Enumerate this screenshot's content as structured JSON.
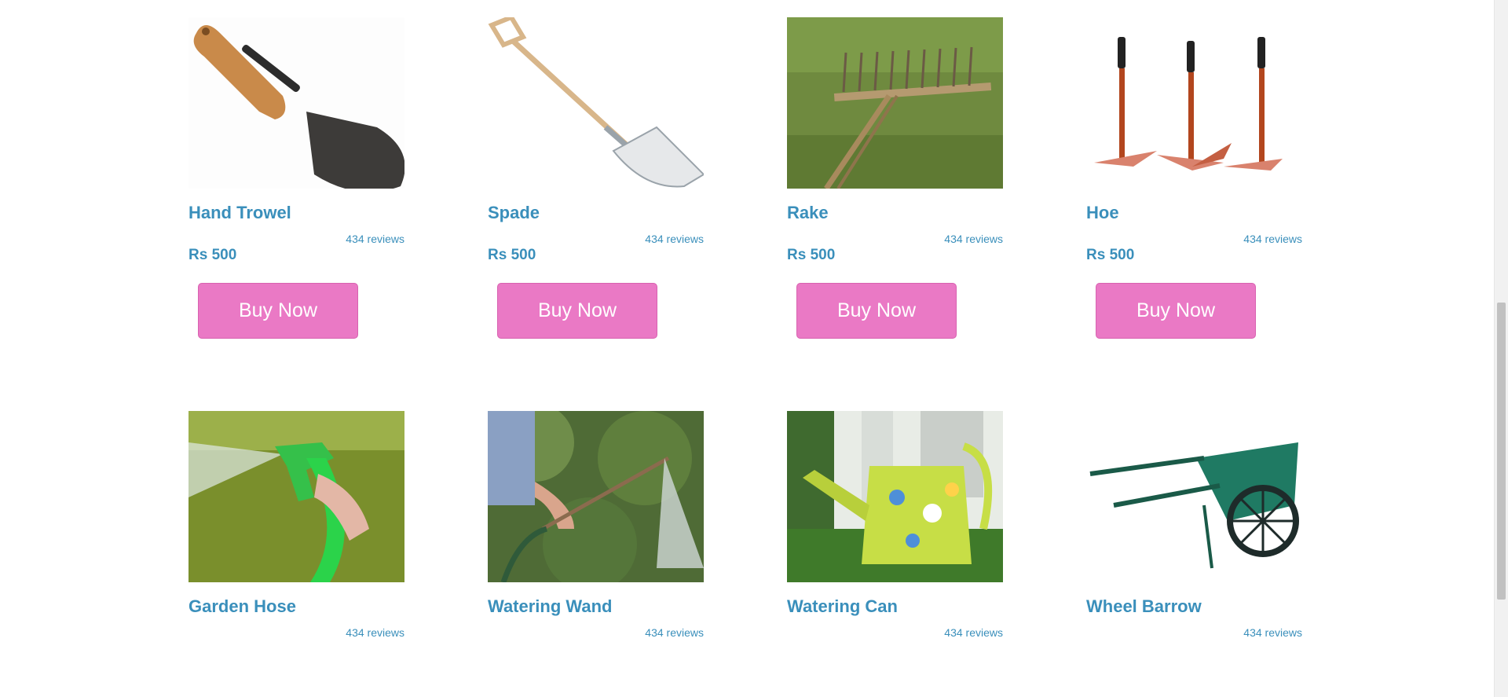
{
  "products": [
    {
      "name": "Hand Trowel",
      "reviews": "434 reviews",
      "price": "Rs 500",
      "button": "Buy Now",
      "icon": "hand-trowel-image"
    },
    {
      "name": "Spade",
      "reviews": "434 reviews",
      "price": "Rs 500",
      "button": "Buy Now",
      "icon": "spade-image"
    },
    {
      "name": "Rake",
      "reviews": "434 reviews",
      "price": "Rs 500",
      "button": "Buy Now",
      "icon": "rake-image"
    },
    {
      "name": "Hoe",
      "reviews": "434 reviews",
      "price": "Rs 500",
      "button": "Buy Now",
      "icon": "hoe-image"
    },
    {
      "name": "Garden Hose",
      "reviews": "434 reviews",
      "price": "",
      "button": "",
      "icon": "garden-hose-image"
    },
    {
      "name": "Watering Wand",
      "reviews": "434 reviews",
      "price": "",
      "button": "",
      "icon": "watering-wand-image"
    },
    {
      "name": "Watering Can",
      "reviews": "434 reviews",
      "price": "",
      "button": "",
      "icon": "watering-can-image"
    },
    {
      "name": "Wheel Barrow",
      "reviews": "434 reviews",
      "price": "",
      "button": "",
      "icon": "wheel-barrow-image"
    }
  ],
  "colors": {
    "title": "#3a8fbb",
    "button": "#ea79c5",
    "button_text": "#ffffff"
  }
}
